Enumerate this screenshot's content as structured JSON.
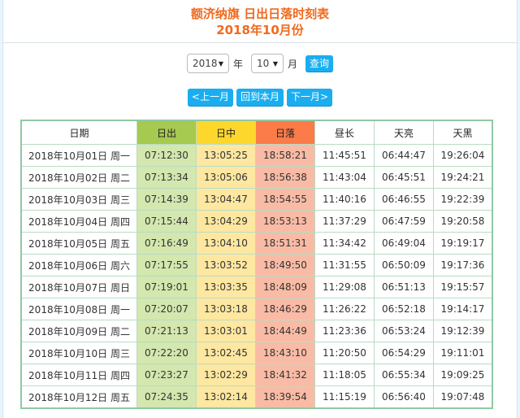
{
  "header": {
    "title": "额济纳旗 日出日落时刻表",
    "subtitle": "2018年10月份"
  },
  "query": {
    "year_value": "2018",
    "year_unit": "年",
    "month_value": "10",
    "month_unit": "月",
    "query_button": "查询",
    "caret": "▼"
  },
  "nav": {
    "prev_month": "<上一月",
    "current_month": "回到本月",
    "next_month": "下一月>"
  },
  "colors": {
    "title": "#f06a1e",
    "button": "#1aaef0",
    "sunrise_header": "#a6c94f",
    "noon_header": "#fed72d",
    "sunset_header": "#fb7b49",
    "sunrise_cell": "#d3e7ae",
    "noon_cell": "#fde7a1",
    "sunset_cell": "#f9bba5",
    "table_border": "#8fc9a3"
  },
  "table": {
    "columns": [
      "日期",
      "日出",
      "日中",
      "日落",
      "昼长",
      "天亮",
      "天黑"
    ],
    "rows": [
      [
        "2018年10月01日 周一",
        "07:12:30",
        "13:05:25",
        "18:58:21",
        "11:45:51",
        "06:44:47",
        "19:26:04"
      ],
      [
        "2018年10月02日 周二",
        "07:13:34",
        "13:05:06",
        "18:56:38",
        "11:43:04",
        "06:45:51",
        "19:24:21"
      ],
      [
        "2018年10月03日 周三",
        "07:14:39",
        "13:04:47",
        "18:54:55",
        "11:40:16",
        "06:46:55",
        "19:22:39"
      ],
      [
        "2018年10月04日 周四",
        "07:15:44",
        "13:04:29",
        "18:53:13",
        "11:37:29",
        "06:47:59",
        "19:20:58"
      ],
      [
        "2018年10月05日 周五",
        "07:16:49",
        "13:04:10",
        "18:51:31",
        "11:34:42",
        "06:49:04",
        "19:19:17"
      ],
      [
        "2018年10月06日 周六",
        "07:17:55",
        "13:03:52",
        "18:49:50",
        "11:31:55",
        "06:50:09",
        "19:17:36"
      ],
      [
        "2018年10月07日 周日",
        "07:19:01",
        "13:03:35",
        "18:48:09",
        "11:29:08",
        "06:51:13",
        "19:15:57"
      ],
      [
        "2018年10月08日 周一",
        "07:20:07",
        "13:03:18",
        "18:46:29",
        "11:26:22",
        "06:52:18",
        "19:14:17"
      ],
      [
        "2018年10月09日 周二",
        "07:21:13",
        "13:03:01",
        "18:44:49",
        "11:23:36",
        "06:53:24",
        "19:12:39"
      ],
      [
        "2018年10月10日 周三",
        "07:22:20",
        "13:02:45",
        "18:43:10",
        "11:20:50",
        "06:54:29",
        "19:11:01"
      ],
      [
        "2018年10月11日 周四",
        "07:23:27",
        "13:02:29",
        "18:41:32",
        "11:18:05",
        "06:55:34",
        "19:09:25"
      ],
      [
        "2018年10月12日 周五",
        "07:24:35",
        "13:02:14",
        "18:39:54",
        "11:15:19",
        "06:56:40",
        "19:07:48"
      ]
    ]
  }
}
